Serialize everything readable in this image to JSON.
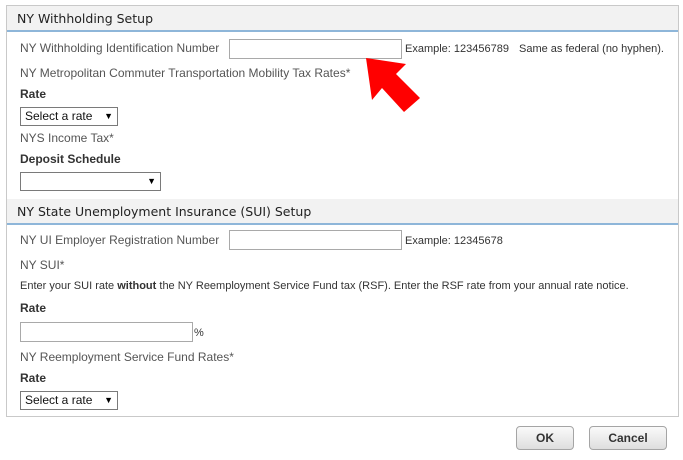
{
  "withholding": {
    "title": "NY Withholding Setup",
    "id_label": "NY Withholding Identification Number",
    "id_value": "",
    "id_example": "Example: 123456789",
    "id_note": "Same as federal (no hyphen).",
    "mctmt_label": "NY Metropolitan Commuter Transportation Mobility Tax Rates*",
    "rate_label": "Rate",
    "rate_select": "Select a rate",
    "income_label": "NYS Income Tax*",
    "deposit_label": "Deposit Schedule",
    "deposit_select": ""
  },
  "sui": {
    "title": "NY State Unemployment Insurance (SUI) Setup",
    "reg_label": "NY UI Employer Registration Number",
    "reg_value": "",
    "reg_example": "Example: 12345678",
    "sui_label": "NY SUI*",
    "note_pre": "Enter your SUI rate ",
    "note_bold": "without",
    "note_post": " the NY Reemployment Service Fund tax (RSF). Enter the RSF rate from your annual rate notice.",
    "rate_label": "Rate",
    "rate_value": "",
    "percent": "%",
    "rsf_label": "NY Reemployment Service Fund Rates*",
    "rsf_rate_label": "Rate",
    "rsf_select": "Select a rate"
  },
  "buttons": {
    "ok": "OK",
    "cancel": "Cancel"
  },
  "colors": {
    "header_border": "#8eb6d9",
    "annotation_arrow": "#ff0000"
  },
  "icons": {
    "dropdown": "dropdown-arrow-icon",
    "annotation": "red-pointer-arrow-icon"
  }
}
